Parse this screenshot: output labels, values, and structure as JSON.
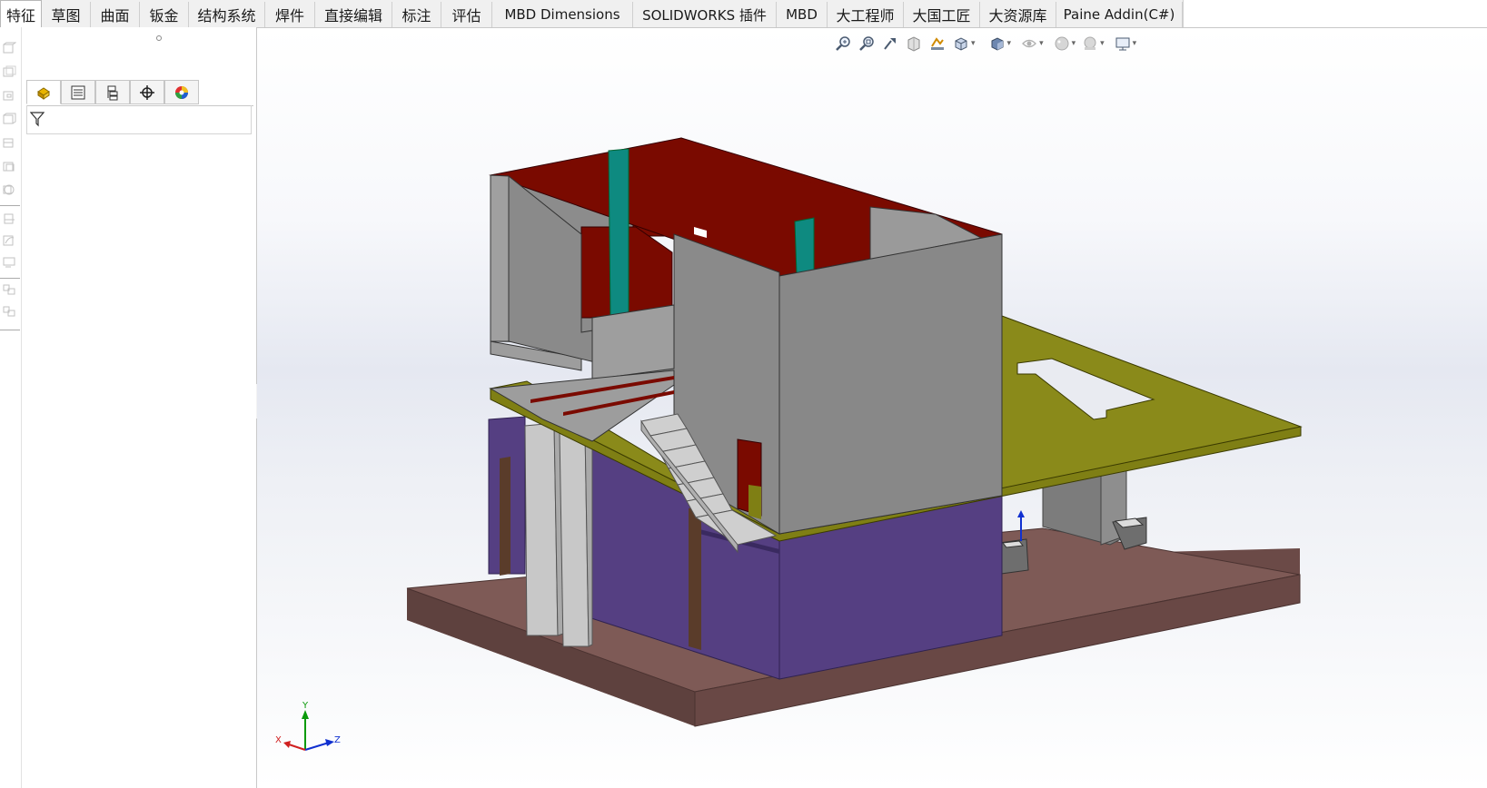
{
  "command_manager": {
    "tabs": [
      {
        "label": "特征",
        "active": true
      },
      {
        "label": "草图"
      },
      {
        "label": "曲面"
      },
      {
        "label": "钣金"
      },
      {
        "label": "结构系统"
      },
      {
        "label": "焊件"
      },
      {
        "label": "直接编辑"
      },
      {
        "label": "标注"
      },
      {
        "label": "评估"
      },
      {
        "label": "MBD Dimensions"
      },
      {
        "label": "SOLIDWORKS 插件"
      },
      {
        "label": "MBD"
      },
      {
        "label": "大工程师"
      },
      {
        "label": "大国工匠"
      },
      {
        "label": "大资源库"
      },
      {
        "label": "Paine Addin(C#)"
      }
    ]
  },
  "feature_manager": {
    "tabs": [
      {
        "icon": "feature-manager-tree-icon",
        "active": true
      },
      {
        "icon": "property-manager-icon"
      },
      {
        "icon": "configuration-manager-icon"
      },
      {
        "icon": "dimxpert-manager-icon"
      },
      {
        "icon": "display-manager-icon"
      }
    ],
    "filter_icon": "filter-icon"
  },
  "heads_up_toolbar": {
    "items": [
      {
        "icon": "zoom-to-fit-icon"
      },
      {
        "icon": "zoom-to-area-icon"
      },
      {
        "icon": "previous-view-icon"
      },
      {
        "icon": "section-view-icon"
      },
      {
        "icon": "dynamic-annotation-views-icon"
      },
      {
        "icon": "view-orientation-icon",
        "dropdown": true
      },
      {
        "icon": "display-style-icon",
        "dropdown": true
      },
      {
        "icon": "hide-show-items-icon",
        "dropdown": true
      },
      {
        "icon": "edit-appearance-icon",
        "dropdown": true
      },
      {
        "icon": "apply-scene-icon",
        "dropdown": true
      },
      {
        "icon": "view-settings-icon",
        "dropdown": true
      }
    ]
  },
  "triad": {
    "x_label": "X",
    "y_label": "Y",
    "z_label": "Z"
  },
  "colors": {
    "base_slab": "#7e5a56",
    "wall_gray": "#8a8a8a",
    "wall_gray_light": "#a6a6a6",
    "wall_purple": "#553f82",
    "floor_olive": "#7f7f14",
    "interior_red": "#7a0a00",
    "window_teal": "#0e8a80",
    "stair_gray": "#c9c9c9"
  }
}
